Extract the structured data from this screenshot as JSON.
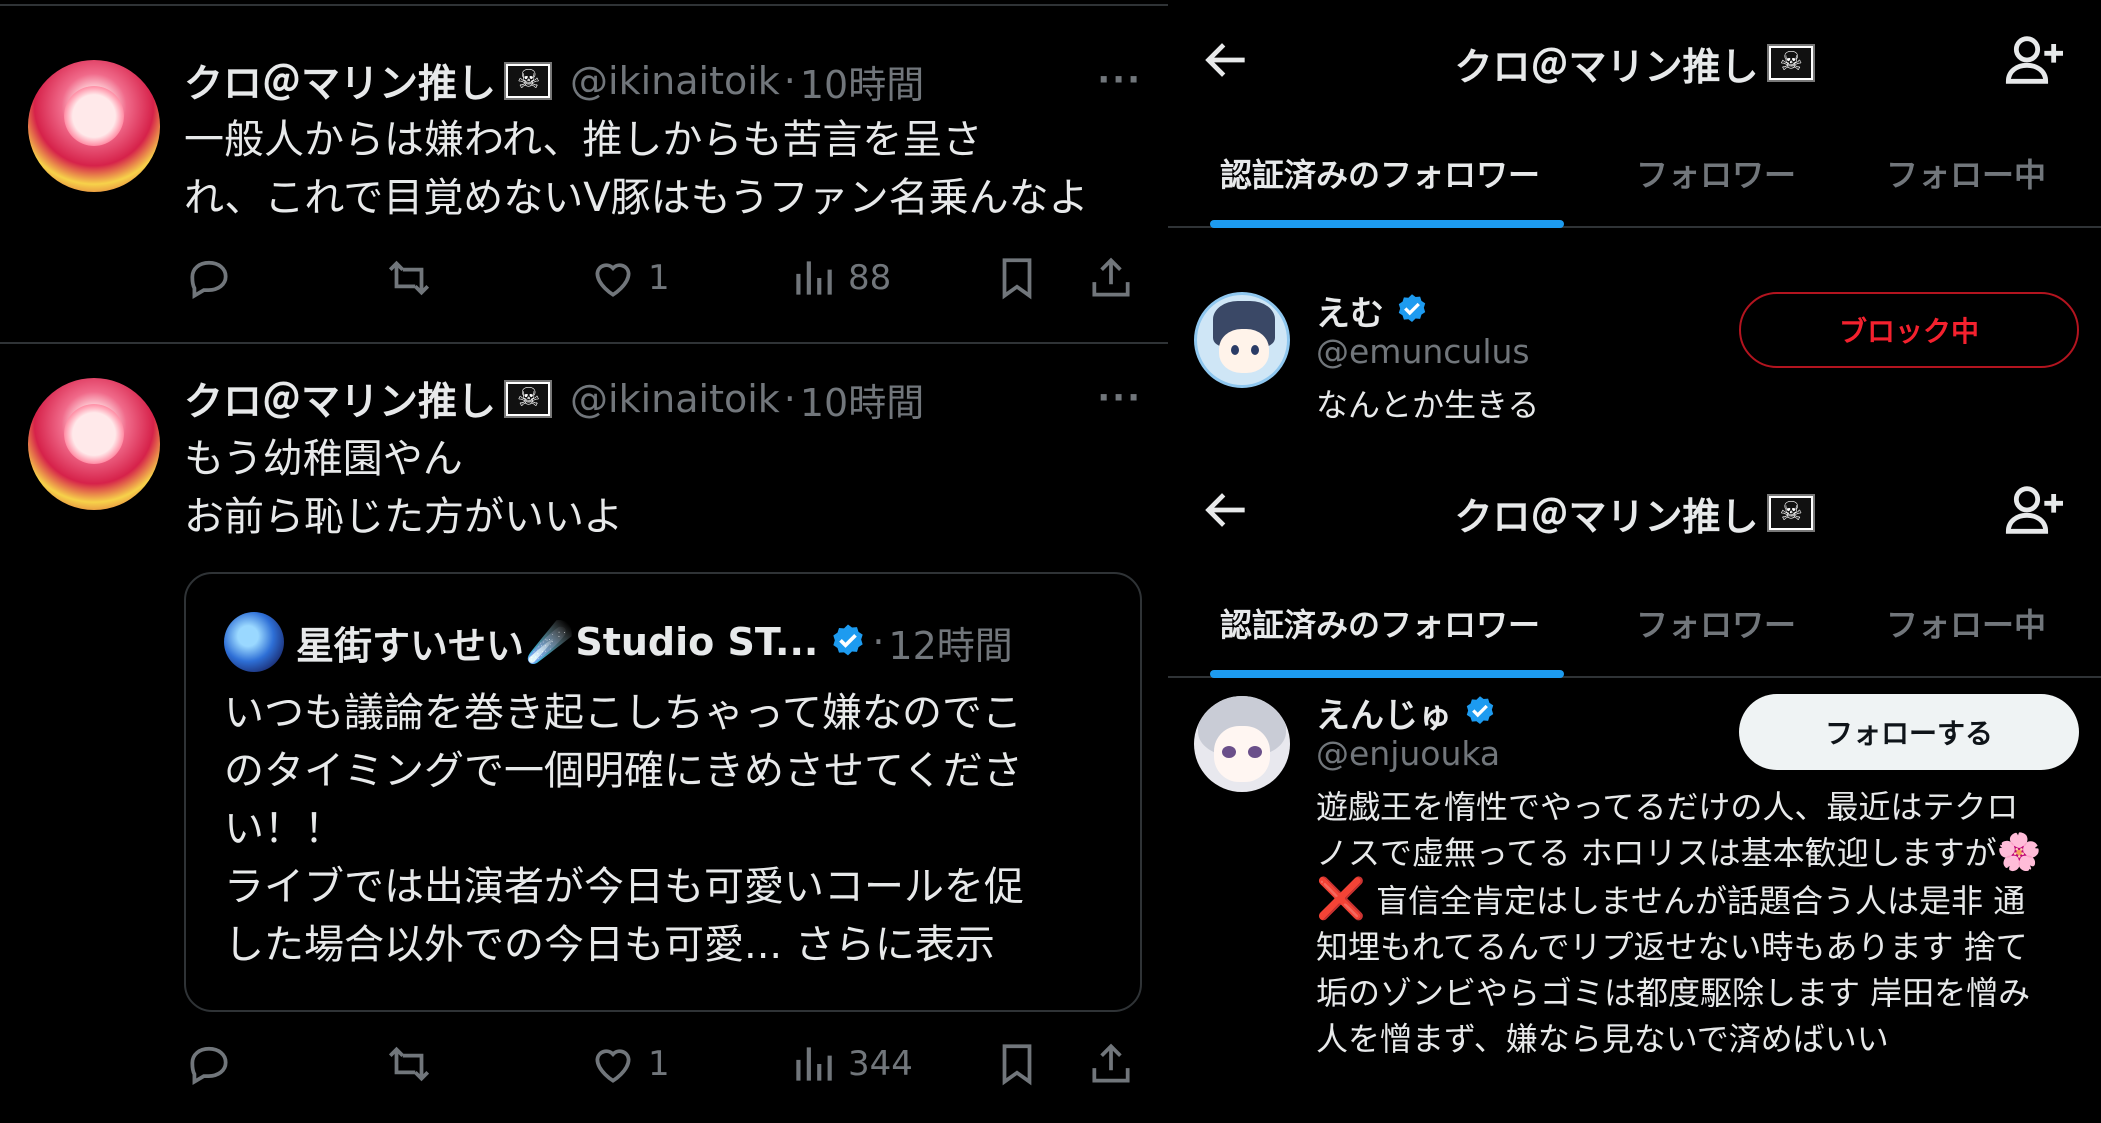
{
  "tweets": [
    {
      "display_name": "クロ＠マリン推し",
      "handle": "@ikinaitoik",
      "dot": "·",
      "time": "10時間",
      "more": "···",
      "text": "一般人からは嫌われ、推しからも苦言を呈さ\nれ、これで目覚めないV豚はもうファン名乗んなよ",
      "likes": "1",
      "views": "88"
    },
    {
      "display_name": "クロ＠マリン推し",
      "handle": "@ikinaitoik",
      "dot": "·",
      "time": "10時間",
      "more": "···",
      "text": "もう幼稚園やん\nお前ら恥じた方がいいよ",
      "likes": "1",
      "views": "344",
      "quote": {
        "name": "星街すいせい",
        "emoji": "☄️",
        "name_suffix": "Studio ST...",
        "dot": "·",
        "time": "12時間",
        "text": "いつも議論を巻き起こしちゃって嫌なのでこ\nのタイミングで一個明確にきめさせてくださ\nい！！\nライブでは出演者が今日も可愛いコールを促\nした場合以外での今日も可愛...",
        "show_more": "さらに表示"
      }
    }
  ],
  "panels": [
    {
      "title": "クロ＠マリン推し",
      "tabs": [
        "認証済みのフォロワー",
        "フォロワー",
        "フォロー中"
      ],
      "user": {
        "name": "えむ",
        "handle": "@emunculus",
        "bio": "なんとか生きる",
        "button": "ブロック中"
      }
    },
    {
      "title": "クロ＠マリン推し",
      "tabs": [
        "認証済みのフォロワー",
        "フォロワー",
        "フォロー中"
      ],
      "user": {
        "name": "えんじゅ",
        "handle": "@enjuouka",
        "bio_1": "遊戯王を惰性でやってるだけの人、最近はテクロ\nノスで虚無ってる ホロリスは基本歓迎しますが",
        "flower": "🌸",
        "bio_x": "❌",
        "bio_2": " 盲信全肯定はしませんが話題合う人は是非 通\n知埋もれてるんでリプ返せない時もあります 捨て\n垢のゾンビやらゴミは都度駆除します 岸田を憎み\n人を憎まず、嫌なら見ないで済めばいい",
        "button": "フォローする"
      }
    }
  ],
  "colors": {
    "background": "#000000",
    "text": "#e7e9ea",
    "muted": "#71767b",
    "divider": "#2f3336",
    "accent": "#1d9bf0",
    "blocked": "#f4212e",
    "verified": "#1d9bf0"
  },
  "icons": [
    "reply-icon",
    "retweet-icon",
    "like-icon",
    "views-icon",
    "bookmark-icon",
    "share-icon",
    "back-arrow-icon",
    "add-user-icon",
    "verified-badge-icon",
    "pirate-flag-icon"
  ]
}
